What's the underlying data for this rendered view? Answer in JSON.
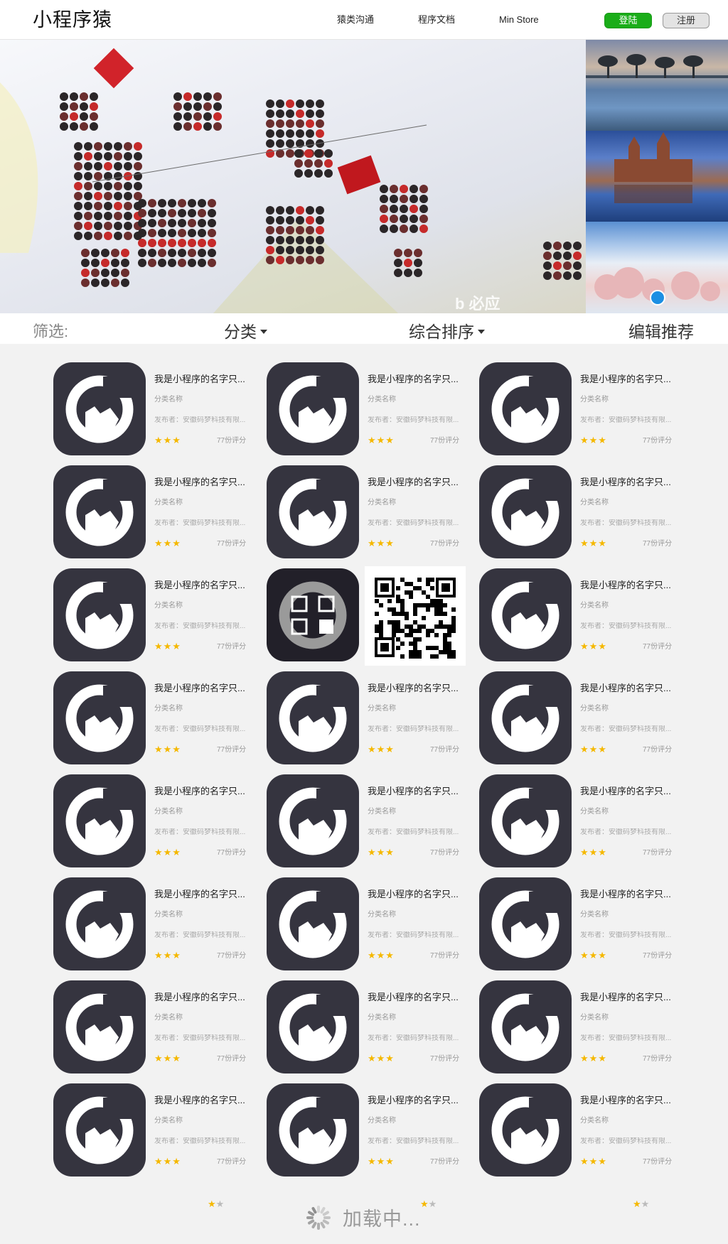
{
  "header": {
    "logo": "小程序猿",
    "nav": [
      {
        "label": "猿类沟通"
      },
      {
        "label": "程序文档"
      },
      {
        "label": "Min Store"
      }
    ],
    "login_label": "登陆",
    "register_label": "注册"
  },
  "banner": {
    "watermark": "b 必应"
  },
  "filter": {
    "label": "筛选:",
    "category": "分类",
    "sort": "综合排序",
    "editor_pick": "编辑推荐"
  },
  "app_card": {
    "name": "我是小程序的名字只...",
    "category": "分类名称",
    "publisher": "发布者：安徽码梦科技有限...",
    "stars": "★★★",
    "ratings": "77份评分"
  },
  "qr_overlay_row": 2,
  "qr_overlay_col": 1,
  "loading": {
    "text": "加载中..."
  },
  "colors": {
    "brand_green": "#1aad19",
    "icon_bg": "#35343f",
    "star": "#f5b800"
  }
}
